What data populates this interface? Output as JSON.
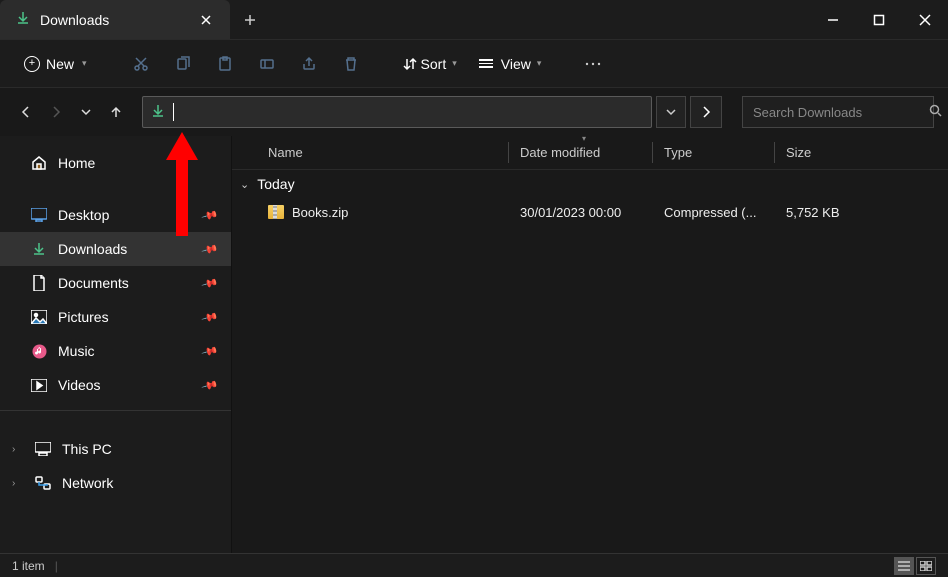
{
  "titlebar": {
    "tab_title": "Downloads"
  },
  "toolbar": {
    "new_label": "New",
    "sort_label": "Sort",
    "view_label": "View"
  },
  "search": {
    "placeholder": "Search Downloads"
  },
  "sidebar": {
    "home": "Home",
    "desktop": "Desktop",
    "downloads": "Downloads",
    "documents": "Documents",
    "pictures": "Pictures",
    "music": "Music",
    "videos": "Videos",
    "thispc": "This PC",
    "network": "Network"
  },
  "columns": {
    "name": "Name",
    "date": "Date modified",
    "type": "Type",
    "size": "Size"
  },
  "group": {
    "today": "Today"
  },
  "files": [
    {
      "name": "Books.zip",
      "date": "30/01/2023 00:00",
      "type": "Compressed (...",
      "size": "5,752 KB"
    }
  ],
  "status": {
    "count": "1 item"
  }
}
